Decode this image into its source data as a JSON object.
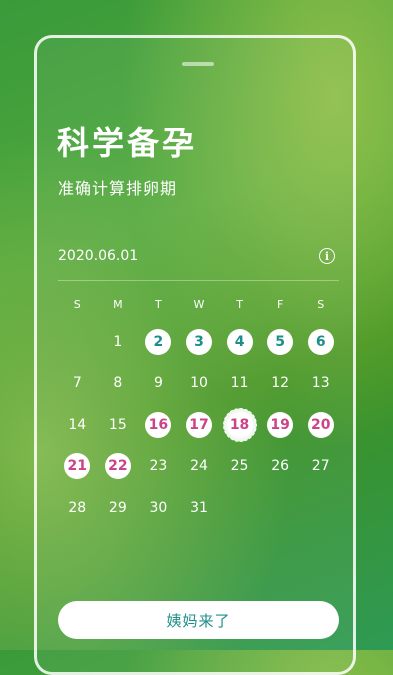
{
  "header": {
    "title": "科学备孕",
    "subtitle": "准确计算排卵期"
  },
  "calendar": {
    "date": "2020.06.01",
    "info_icon": "info-icon",
    "weekdays": [
      "S",
      "M",
      "T",
      "W",
      "T",
      "F",
      "S"
    ],
    "start_offset": 1,
    "days": [
      {
        "d": "1",
        "type": "normal"
      },
      {
        "d": "2",
        "type": "period"
      },
      {
        "d": "3",
        "type": "period"
      },
      {
        "d": "4",
        "type": "period"
      },
      {
        "d": "5",
        "type": "period"
      },
      {
        "d": "6",
        "type": "period"
      },
      {
        "d": "7",
        "type": "normal"
      },
      {
        "d": "8",
        "type": "normal"
      },
      {
        "d": "9",
        "type": "normal"
      },
      {
        "d": "10",
        "type": "normal"
      },
      {
        "d": "11",
        "type": "normal"
      },
      {
        "d": "12",
        "type": "normal"
      },
      {
        "d": "13",
        "type": "normal"
      },
      {
        "d": "14",
        "type": "normal"
      },
      {
        "d": "15",
        "type": "normal"
      },
      {
        "d": "16",
        "type": "ovulation"
      },
      {
        "d": "17",
        "type": "ovulation"
      },
      {
        "d": "18",
        "type": "today"
      },
      {
        "d": "19",
        "type": "ovulation"
      },
      {
        "d": "20",
        "type": "ovulation"
      },
      {
        "d": "21",
        "type": "ovulation"
      },
      {
        "d": "22",
        "type": "ovulation"
      },
      {
        "d": "23",
        "type": "normal"
      },
      {
        "d": "24",
        "type": "normal"
      },
      {
        "d": "25",
        "type": "normal"
      },
      {
        "d": "26",
        "type": "normal"
      },
      {
        "d": "27",
        "type": "normal"
      },
      {
        "d": "28",
        "type": "normal"
      },
      {
        "d": "29",
        "type": "normal"
      },
      {
        "d": "30",
        "type": "normal"
      },
      {
        "d": "31",
        "type": "normal"
      }
    ]
  },
  "action": {
    "button_label": "姨妈来了"
  },
  "colors": {
    "period": "#1d8f88",
    "ovulation": "#cc4488",
    "background": "#3c8f1e"
  }
}
